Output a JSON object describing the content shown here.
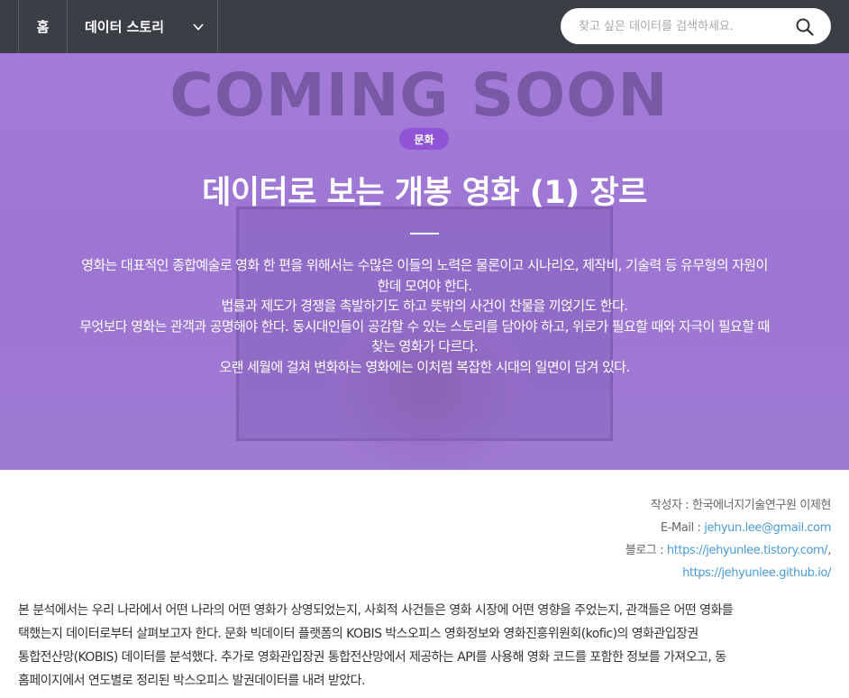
{
  "nav": {
    "home_label": "홈",
    "story_label": "데이터 스토리",
    "story_icon": "chevron-down-icon",
    "search_placeholder": "찾고 싶은 데이터를 검색하세요.",
    "search_icon": "search-icon"
  },
  "hero": {
    "background_text": "COMING SOON",
    "category": "문화",
    "title": "데이터로 보는 개봉 영화 (1) 장르",
    "intro_lines": [
      "영화는 대표적인 종합예술로 영화 한 편을 위해서는 수많은 이들의 노력은 물론이고 시나리오, 제작비, 기술력 등 유무형의 자원이",
      "한데 모여야 한다.",
      "법률과 제도가 경쟁을 촉발하기도 하고 뜻밖의 사건이 찬물을 끼얹기도 한다.",
      "무엇보다 영화는 관객과 공명해야 한다. 동시대인들이 공감할 수 있는 스토리를 담아야 하고, 위로가 필요할 때와 자극이 필요할 때",
      "찾는 영화가 다르다.",
      "오랜 세월에 걸쳐 변화하는 영화에는 이처럼 복잡한 시대의 일면이 담겨 있다."
    ],
    "badge_color": "#8f55d6"
  },
  "author": {
    "writer": "작성자 : 한국에너지기술연구원 이제현",
    "email_label": "E-Mail : ",
    "email": "jehyun.lee@gmail.com",
    "blog_label": "블로그 : ",
    "blog_1": "https://jehyunlee.tistory.com/",
    "blog_sep": ",",
    "blog_2": "https://jehyunlee.github.io/"
  },
  "body": {
    "lines": [
      "본 분석에서는 우리 나라에서 어떤 나라의 어떤 영화가 상영되었는지, 사회적 사건들은 영화 시장에 어떤 영향을 주었는지, 관객들은 어떤 영화를",
      "택했는지 데이터로부터 살펴보고자 한다. 문화 빅데이터 플랫폼의 KOBIS 박스오피스 영화정보와 영화진흥위원회(kofic)의 영화관입장권",
      "통합전산망(KOBIS) 데이터를 분석했다. 추가로 영화관입장권 통합전산망에서 제공하는 API를 사용해 영화 코드를 포함한 정보를 가져오고, 동",
      "홈페이지에서 연도별로 정리된 박스오피스 발권데이터를 내려 받았다."
    ]
  }
}
